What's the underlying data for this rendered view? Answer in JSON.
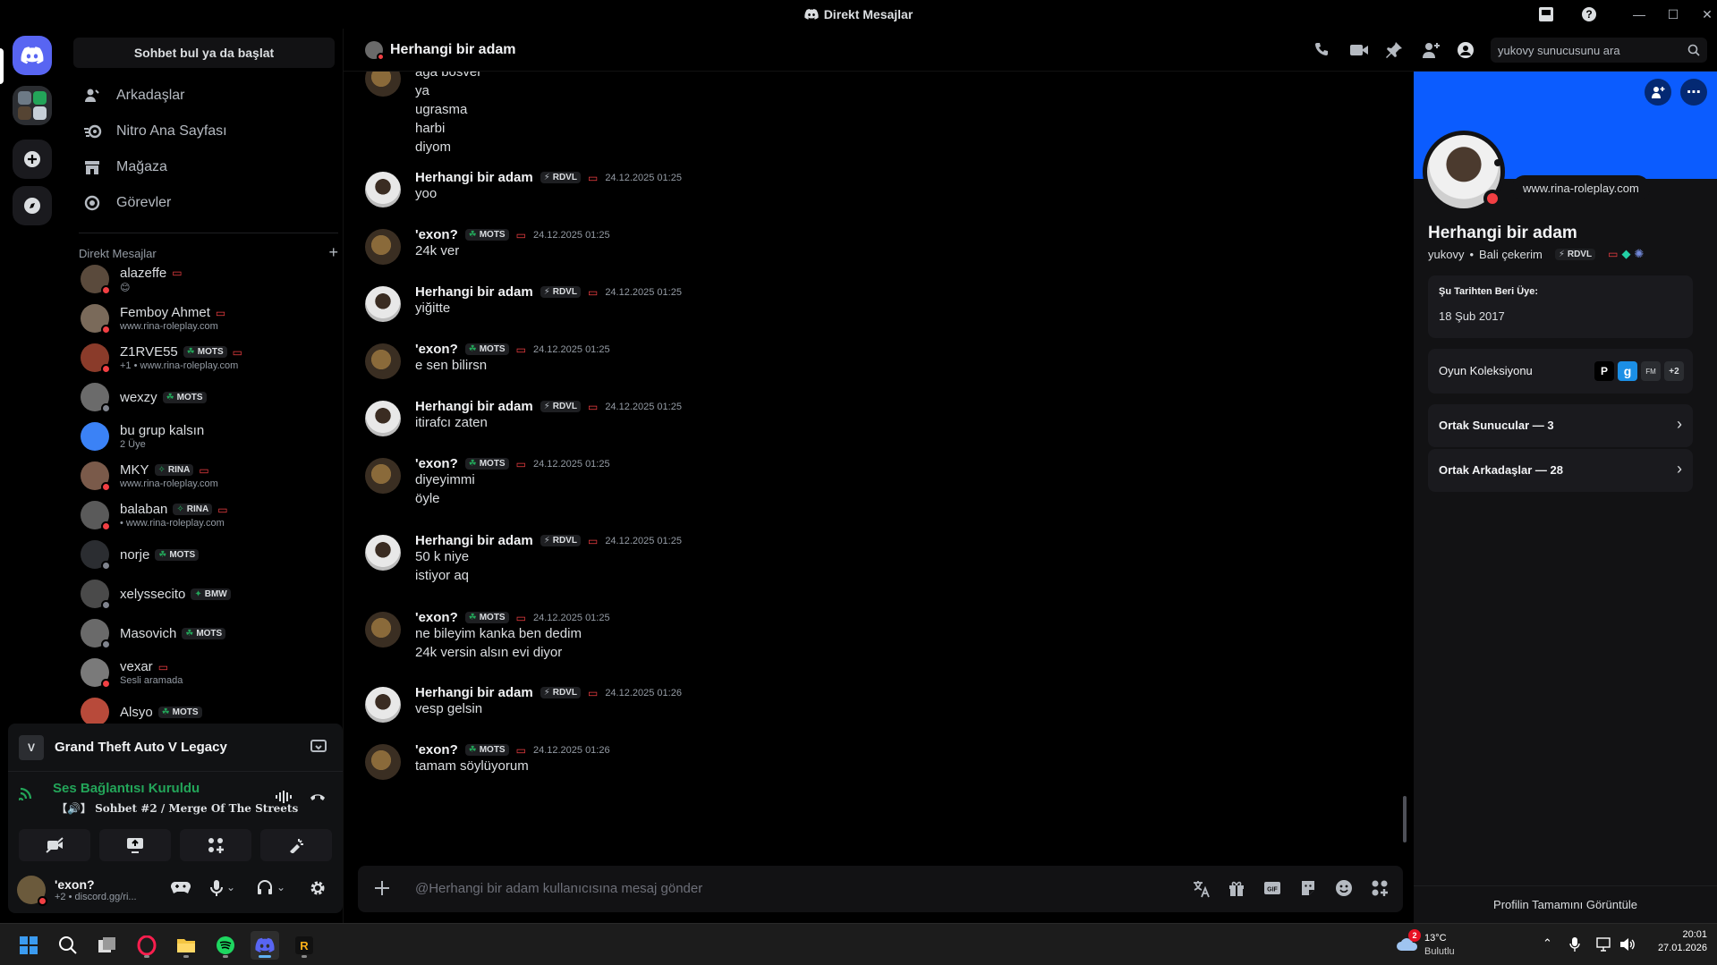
{
  "window": {
    "title": "Direkt Mesajlar"
  },
  "sidebar": {
    "search_label": "Sohbet bul ya da başlat",
    "nav": [
      {
        "label": "Arkadaşlar",
        "icon": "friends-icon"
      },
      {
        "label": "Nitro Ana Sayfası",
        "icon": "nitro-icon"
      },
      {
        "label": "Mağaza",
        "icon": "shop-icon"
      },
      {
        "label": "Görevler",
        "icon": "quests-icon"
      }
    ],
    "dm_header": "Direkt Mesajlar",
    "dms": [
      {
        "name": "alazeffe",
        "sub": "😊",
        "tag": "",
        "status": "#f23f43",
        "monitor": true
      },
      {
        "name": "Femboy Ahmet",
        "sub": "www.rina-roleplay.com",
        "tag": "",
        "status": "#f23f43",
        "monitor": true
      },
      {
        "name": "Z1RVE55",
        "sub": "+1 • www.rina-roleplay.com",
        "tag": "MOTS",
        "status": "#f23f43",
        "monitor": true
      },
      {
        "name": "wexzy",
        "sub": "",
        "tag": "MOTS",
        "status": "#80848e",
        "monitor": false
      },
      {
        "name": "bu grup kalsın",
        "sub": "2 Üye",
        "tag": "",
        "status": "",
        "monitor": false
      },
      {
        "name": "MKY",
        "sub": "www.rina-roleplay.com",
        "tag": "RINA",
        "status": "#f23f43",
        "monitor": true
      },
      {
        "name": "balaban",
        "sub": "• www.rina-roleplay.com",
        "tag": "RINA",
        "status": "#f23f43",
        "monitor": true
      },
      {
        "name": "norje",
        "sub": "",
        "tag": "MOTS",
        "status": "#80848e",
        "monitor": false
      },
      {
        "name": "xelyssecito",
        "sub": "",
        "tag": "BMW",
        "status": "#80848e",
        "monitor": false
      },
      {
        "name": "Masovich",
        "sub": "",
        "tag": "MOTS",
        "status": "#80848e",
        "monitor": false
      },
      {
        "name": "vexar",
        "sub": "Sesli aramada",
        "tag": "",
        "status": "#f23f43",
        "monitor": true
      },
      {
        "name": "Alsyo",
        "sub": "",
        "tag": "MOTS",
        "status": "",
        "monitor": false
      }
    ]
  },
  "game_panel": {
    "game": "Grand Theft Auto V Legacy",
    "voice_status": "Ses Bağlantısı Kuruldu",
    "voice_channel": "【🔊】 Sohbet #2 / Merge Of The Streets",
    "user_name": "'exon?",
    "user_sub": "+2 • discord.gg/ri..."
  },
  "chat": {
    "recipient": "Herhangi bir adam",
    "search_placeholder": "yukovy sunucusunu ara",
    "composer_placeholder": "@Herhangi bir adam kullanıcısına mesaj gönder",
    "messages": [
      {
        "author": "",
        "tag": "",
        "time": "",
        "lines": [
          "aga bosver",
          "ya",
          "ugrasma",
          "harbi",
          "diyom"
        ],
        "who": "exon"
      },
      {
        "author": "Herhangi bir adam",
        "tag": "RDVL",
        "time": "24.12.2025 01:25",
        "lines": [
          "yoo"
        ],
        "who": "adam"
      },
      {
        "author": "'exon?",
        "tag": "MOTS",
        "time": "24.12.2025 01:25",
        "lines": [
          "24k ver"
        ],
        "who": "exon"
      },
      {
        "author": "Herhangi bir adam",
        "tag": "RDVL",
        "time": "24.12.2025 01:25",
        "lines": [
          "yiğitte"
        ],
        "who": "adam"
      },
      {
        "author": "'exon?",
        "tag": "MOTS",
        "time": "24.12.2025 01:25",
        "lines": [
          "e sen bilirsn"
        ],
        "who": "exon"
      },
      {
        "author": "Herhangi bir adam",
        "tag": "RDVL",
        "time": "24.12.2025 01:25",
        "lines": [
          "itirafcı zaten"
        ],
        "who": "adam"
      },
      {
        "author": "'exon?",
        "tag": "MOTS",
        "time": "24.12.2025 01:25",
        "lines": [
          "diyeyimmi",
          "öyle"
        ],
        "who": "exon"
      },
      {
        "author": "Herhangi bir adam",
        "tag": "RDVL",
        "time": "24.12.2025 01:25",
        "lines": [
          "50 k niye",
          "istiyor aq"
        ],
        "who": "adam"
      },
      {
        "author": "'exon?",
        "tag": "MOTS",
        "time": "24.12.2025 01:25",
        "lines": [
          "ne bileyim kanka ben dedim",
          "24k versin alsın evi diyor"
        ],
        "who": "exon"
      },
      {
        "author": "Herhangi bir adam",
        "tag": "RDVL",
        "time": "24.12.2025 01:26",
        "lines": [
          "vesp gelsin"
        ],
        "who": "adam"
      },
      {
        "author": "'exon?",
        "tag": "MOTS",
        "time": "24.12.2025 01:26",
        "lines": [
          "tamam söylüyorum"
        ],
        "who": "exon"
      }
    ]
  },
  "profile": {
    "activity_bubble": "www.rina-roleplay.com",
    "display_name": "Herhangi bir adam",
    "username": "yukovy",
    "pronouns": "Bali çekerim",
    "tag": "RDVL",
    "member_since_label": "Şu Tarihten Beri Üye:",
    "member_since": "18 Şub 2017",
    "game_collection": "Oyun Koleksiyonu",
    "game_more": "+2",
    "mutual_servers": "Ortak Sunucular — 3",
    "mutual_friends": "Ortak Arkadaşlar — 28",
    "view_full": "Profilin Tamamını Görüntüle",
    "banner_color": "#0b5cff"
  },
  "taskbar": {
    "weather_temp": "13°C",
    "weather_desc": "Bulutlu",
    "weather_badge": "2",
    "time": "20:01",
    "date": "27.01.2026"
  }
}
